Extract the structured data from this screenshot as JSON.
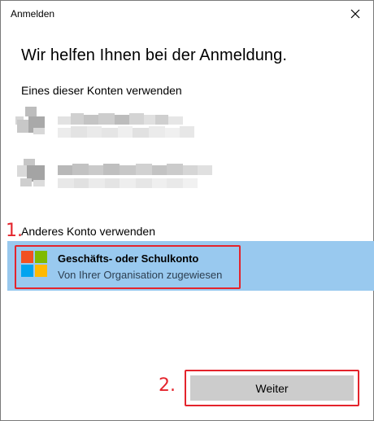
{
  "window": {
    "title": "Anmelden"
  },
  "heading": "Wir helfen Ihnen bei der Anmeldung.",
  "existing_accounts": {
    "label": "Eines dieser Konten verwenden"
  },
  "other_account": {
    "label": "Anderes Konto verwenden",
    "option_title": "Geschäfts- oder Schulkonto",
    "option_subtitle": "Von Ihrer Organisation zugewiesen"
  },
  "annotations": {
    "step1": "1.",
    "step2": "2."
  },
  "footer": {
    "continue_label": "Weiter"
  },
  "colors": {
    "selection": "#99c9ef",
    "annotation_red": "#e4242c",
    "button": "#cccccc"
  },
  "icons": {
    "close": "close-icon",
    "org": "microsoft-logo-icon"
  }
}
